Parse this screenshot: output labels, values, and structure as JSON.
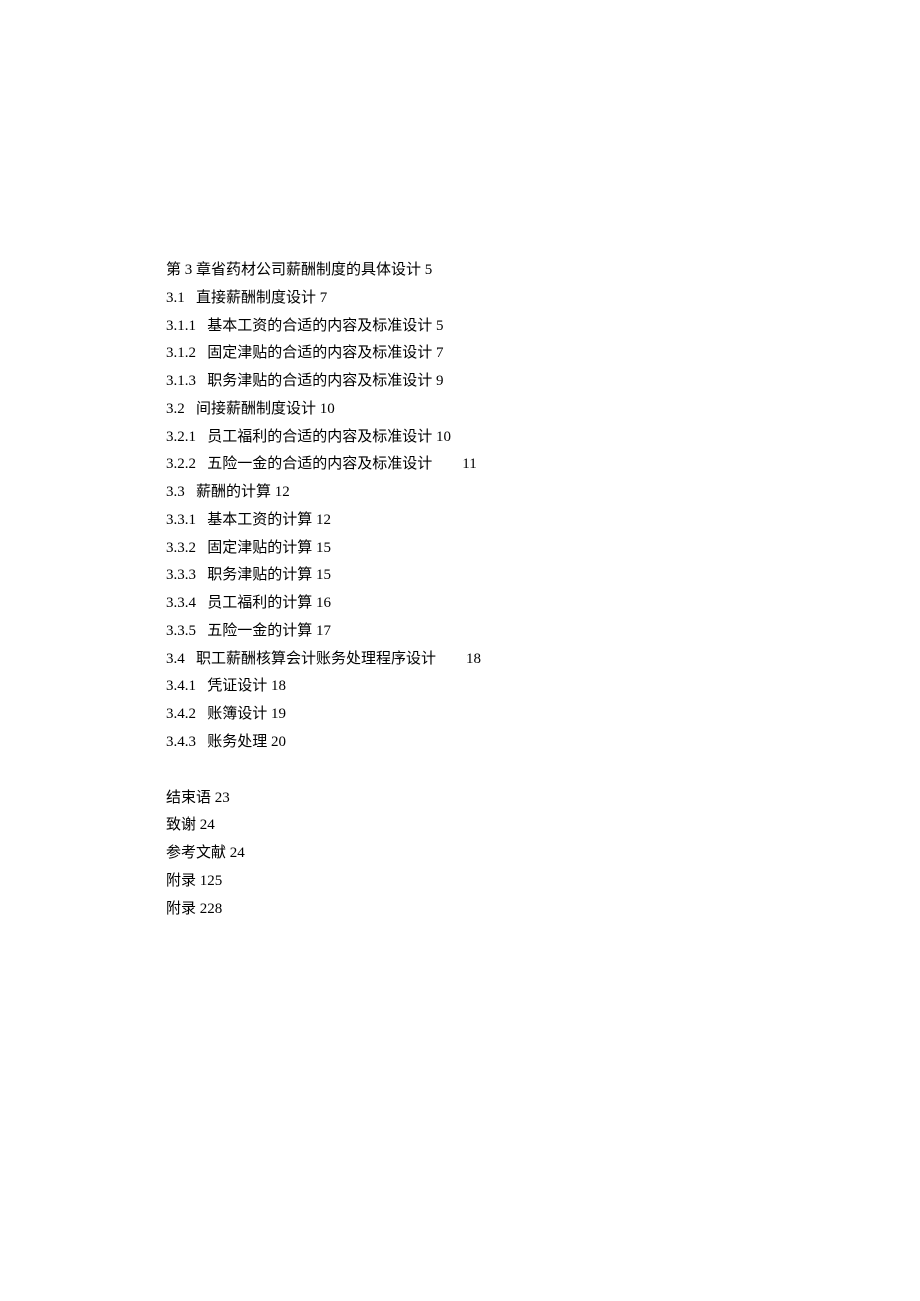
{
  "toc": {
    "chapter3": {
      "title": "第 3 章省药材公司薪酬制度的具体设计 5",
      "items": [
        "3.1   直接薪酬制度设计 7",
        "3.1.1   基本工资的合适的内容及标准设计 5",
        "3.1.2   固定津贴的合适的内容及标准设计 7",
        "3.1.3   职务津贴的合适的内容及标准设计 9",
        "3.2   间接薪酬制度设计 10",
        "3.2.1   员工福利的合适的内容及标准设计 10",
        "3.2.2   五险一金的合适的内容及标准设计        11",
        "3.3   薪酬的计算 12",
        "3.3.1   基本工资的计算 12",
        "3.3.2   固定津贴的计算 15",
        "3.3.3   职务津贴的计算 15",
        "3.3.4   员工福利的计算 16",
        "3.3.5   五险一金的计算 17",
        "3.4   职工薪酬核算会计账务处理程序设计        18",
        "3.4.1   凭证设计 18",
        "3.4.2   账簿设计 19",
        "3.4.3   账务处理 20"
      ]
    },
    "appendix": [
      "结束语 23",
      "致谢 24",
      "参考文献 24",
      "附录 125",
      "附录 228"
    ]
  }
}
